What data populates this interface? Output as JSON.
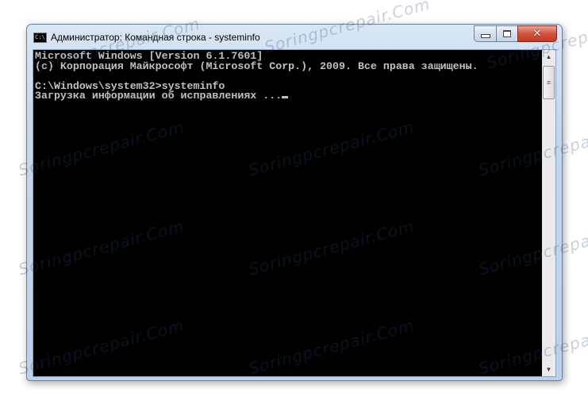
{
  "window": {
    "title": "Администратор: Командная строка - systeminfo",
    "icon": "cmd-icon",
    "icon_text": "C:\\",
    "buttons": {
      "minimize": "minimize-icon",
      "maximize": "maximize-icon",
      "close": "close-icon"
    }
  },
  "console": {
    "lines": [
      "Microsoft Windows [Version 6.1.7601]",
      "(c) Корпорация Майкрософт (Microsoft Corp.), 2009. Все права защищены.",
      "",
      "C:\\Windows\\system32>systeminfo",
      "Загрузка информации об исправлениях ..."
    ]
  },
  "watermark": "Soringpcrepair.Com"
}
